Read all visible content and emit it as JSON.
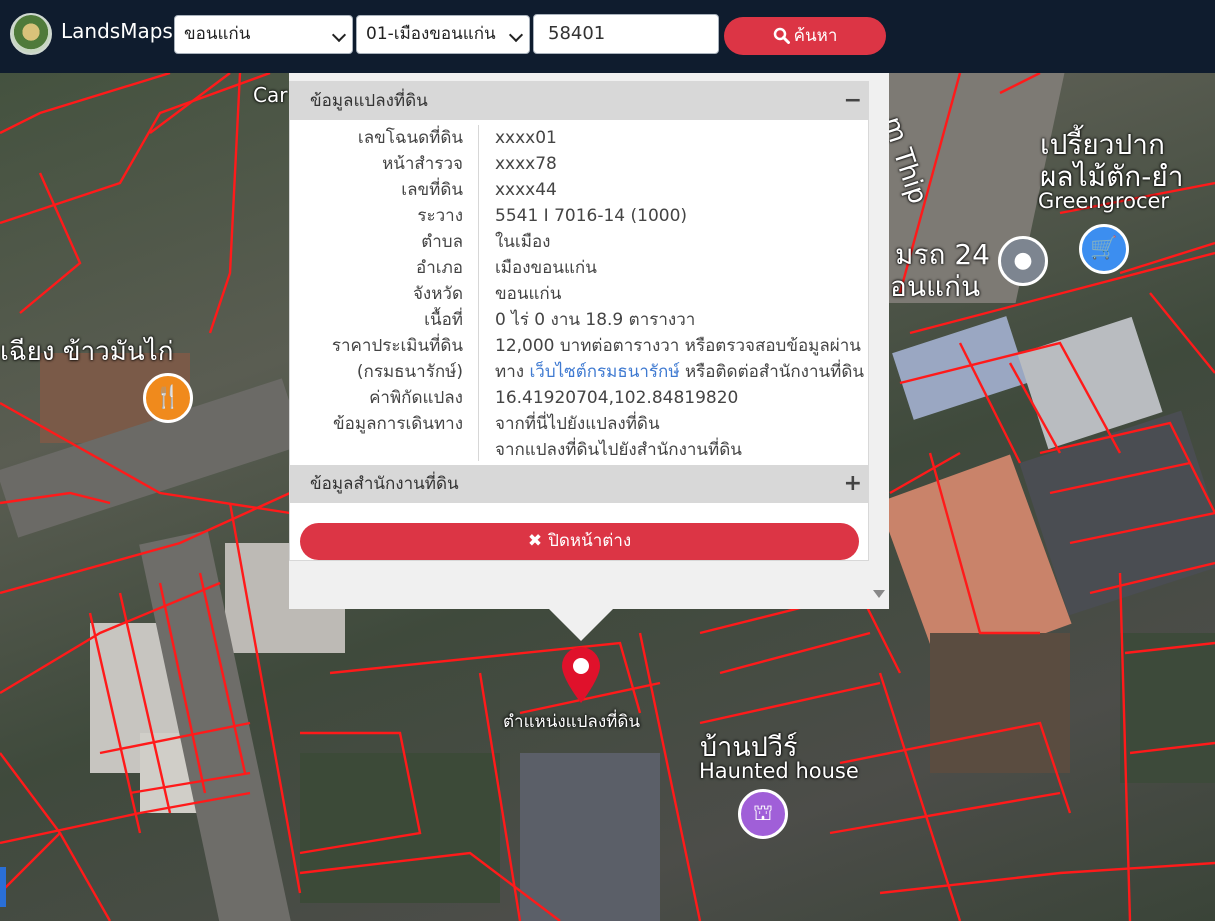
{
  "navbar": {
    "brand": "LandsMaps",
    "province_select": "ขอนแก่น",
    "amphur_select": "01-เมืองขอนแก่น",
    "parcel_input": "58401",
    "search_label": "ค้นหา"
  },
  "map_labels": {
    "shop1_line1": "เปรี้ยวปาก",
    "shop1_line2": "ผลไม้ตัก-ยำ",
    "shop1_line3": "Greengrocer",
    "car_line1": "มรถ 24",
    "car_line2": "อนแก่น",
    "road": "m Thip",
    "rest": "เฉียง ข้าวมันไก่",
    "car_top": "Car",
    "haunted_th": "บ้านปวีร์",
    "haunted_en": "Haunted house"
  },
  "popup": {
    "land_header": "ข้อมูลแปลงที่ดิน",
    "land_toggle": "−",
    "rows": [
      {
        "label": "เลขโฉนดที่ดิน",
        "value": "xxxx01"
      },
      {
        "label": "หน้าสำรวจ",
        "value": "xxxx78"
      },
      {
        "label": "เลขที่ดิน",
        "value": "xxxx44"
      },
      {
        "label": "ระวาง",
        "value": "5541 I 7016-14 (1000)"
      },
      {
        "label": "ตำบล",
        "value": "ในเมือง"
      },
      {
        "label": "อำเภอ",
        "value": "เมืองขอนแก่น"
      },
      {
        "label": "จังหวัด",
        "value": "ขอนแก่น"
      },
      {
        "label": "เนื้อที่",
        "value": "0 ไร่ 0 งาน 18.9 ตารางวา"
      }
    ],
    "price": {
      "label1": "ราคาประเมินที่ดิน",
      "label2": "(กรมธนารักษ์)",
      "line1": "12,000 บาทต่อตารางวา หรือตรวจสอบข้อมูลผ่าน",
      "line2_pre": "ทาง",
      "line2_link": "เว็บไซต์กรมธนารักษ์",
      "line2_post": "หรือติดต่อสำนักงานที่ดิน"
    },
    "coord": {
      "label": "ค่าพิกัดแปลง",
      "value": "16.41920704,102.84819820"
    },
    "travel": {
      "label": "ข้อมูลการเดินทาง",
      "link1": "จากที่นี่ไปยังแปลงที่ดิน",
      "link2": "จากแปลงที่ดินไปยังสำนักงานที่ดิน"
    },
    "office_header": "ข้อมูลสำนักงานที่ดิน",
    "office_toggle": "+",
    "close_label": "ปิดหน้าต่าง"
  },
  "marker_label": "ตำแหน่งแปลงที่ดิน",
  "colors": {
    "accent": "#dc3545",
    "navbar": "#0f1c2e",
    "link": "#3f7ad1",
    "parcel_lines": "#ff1a1a"
  }
}
